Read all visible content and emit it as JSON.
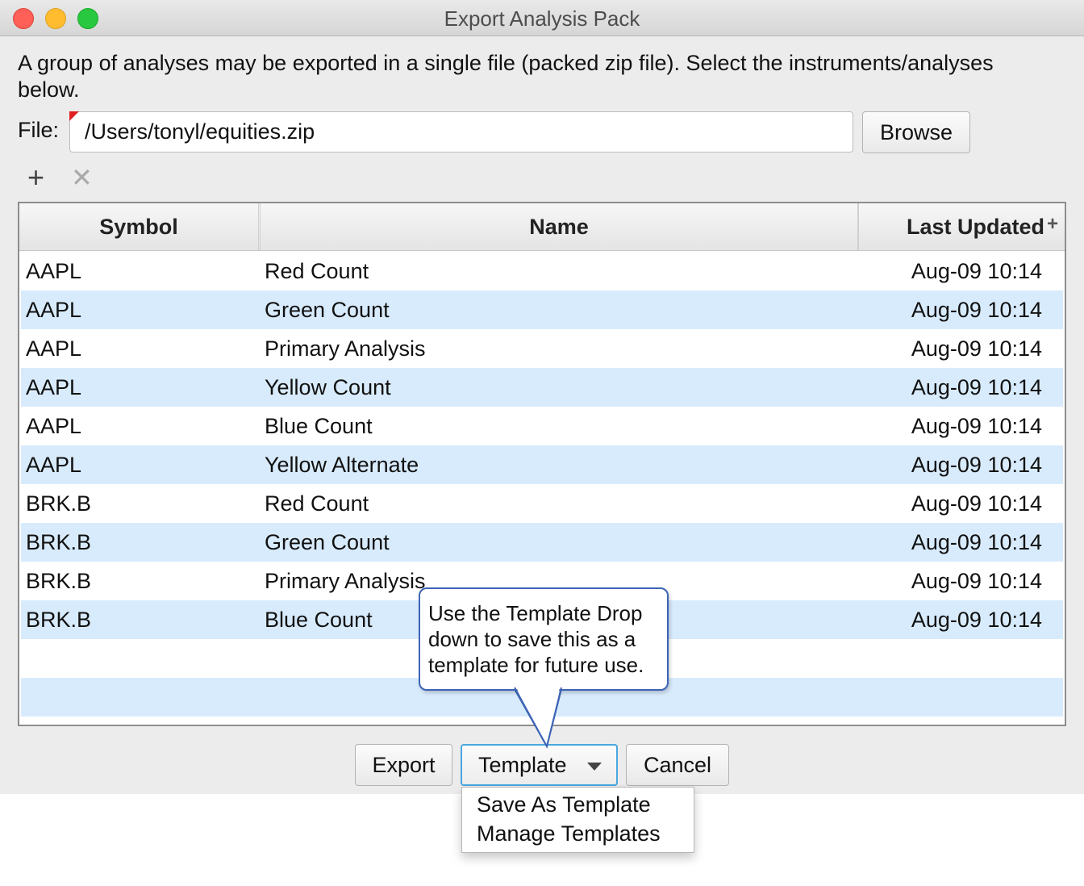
{
  "window": {
    "title": "Export Analysis Pack"
  },
  "description": "A group of analyses may be exported in a single file (packed zip file). Select the instruments/analyses below.",
  "file": {
    "label": "File:",
    "value": "/Users/tonyl/equities.zip",
    "browse_label": "Browse"
  },
  "toolbar": {
    "add_icon": "+",
    "remove_icon": "✕"
  },
  "table": {
    "columns": [
      "Symbol",
      "Name",
      "Last Updated"
    ],
    "add_column_icon": "+",
    "rows": [
      {
        "symbol": "AAPL",
        "name": "Red Count",
        "updated": "Aug-09 10:14"
      },
      {
        "symbol": "AAPL",
        "name": "Green Count",
        "updated": "Aug-09 10:14"
      },
      {
        "symbol": "AAPL",
        "name": "Primary Analysis",
        "updated": "Aug-09 10:14"
      },
      {
        "symbol": "AAPL",
        "name": "Yellow Count",
        "updated": "Aug-09 10:14"
      },
      {
        "symbol": "AAPL",
        "name": "Blue Count",
        "updated": "Aug-09 10:14"
      },
      {
        "symbol": "AAPL",
        "name": "Yellow Alternate",
        "updated": "Aug-09 10:14"
      },
      {
        "symbol": "BRK.B",
        "name": "Red Count",
        "updated": "Aug-09 10:14"
      },
      {
        "symbol": "BRK.B",
        "name": "Green Count",
        "updated": "Aug-09 10:14"
      },
      {
        "symbol": "BRK.B",
        "name": "Primary Analysis",
        "updated": "Aug-09 10:14"
      },
      {
        "symbol": "BRK.B",
        "name": "Blue Count",
        "updated": "Aug-09 10:14"
      },
      {
        "symbol": "",
        "name": "",
        "updated": ""
      },
      {
        "symbol": "",
        "name": "",
        "updated": ""
      }
    ],
    "row_stripe_color": "#d8ebfc"
  },
  "callout": {
    "text": "Use the Template Drop down to save this as a template for future use."
  },
  "buttons": {
    "export": "Export",
    "template": "Template",
    "cancel": "Cancel"
  },
  "template_menu": {
    "items": [
      "Save As Template",
      "Manage Templates"
    ]
  },
  "colors": {
    "accent": "#48a7e0",
    "callout_border": "#3d64b5",
    "required_marker": "#e02020"
  }
}
